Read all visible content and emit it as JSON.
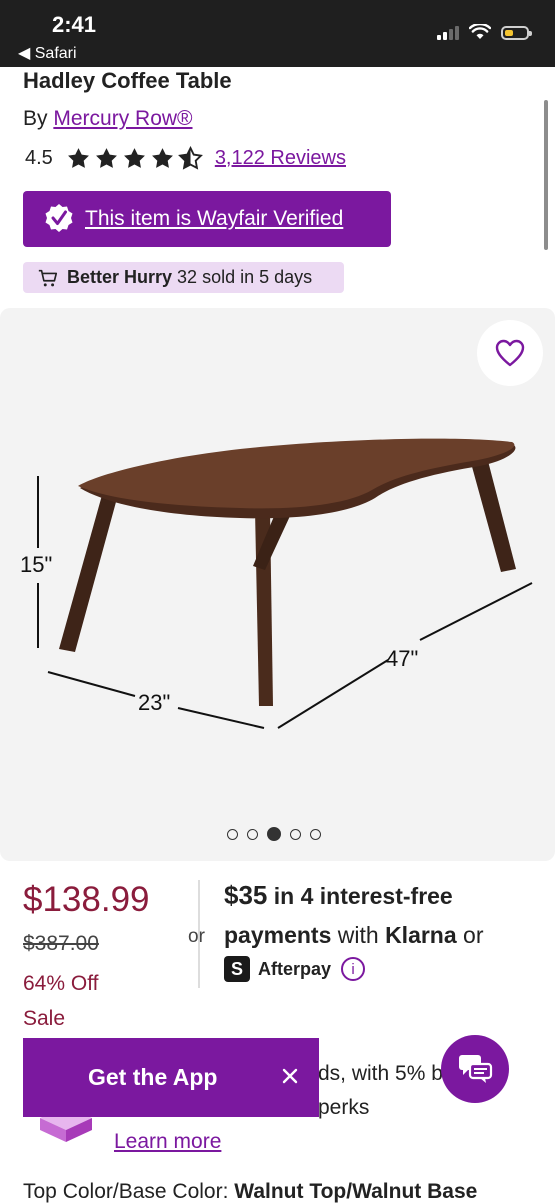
{
  "status_bar": {
    "time": "2:41",
    "back_label": "◀ Safari"
  },
  "product": {
    "title": "Hadley Coffee Table",
    "by_prefix": "By",
    "brand": "Mercury Row®",
    "rating": "4.5",
    "stars_value": 4.5,
    "reviews": "3,122 Reviews",
    "verified": "This item is Wayfair Verified",
    "hurry_bold": "Better Hurry",
    "hurry_text": "32 sold in 5 days"
  },
  "gallery": {
    "dims": {
      "height": "15\"",
      "depth": "23\"",
      "width": "47\""
    },
    "dots_total": 5,
    "active_dot": 3
  },
  "pricing": {
    "price": "$138.99",
    "original": "$387.00",
    "discount": "64% Off",
    "sale": "Sale",
    "or": "or",
    "klarna_amount": "$35",
    "klarna_line1_rest": "in 4 interest-free",
    "klarna_payments": "payments",
    "klarna_with": "with",
    "klarna_brand": "Klarna",
    "klarna_or": "or",
    "afterpay_icon": "S",
    "afterpay": "Afterpay",
    "info_icon": "i"
  },
  "card_promo": {
    "line1": "ds, with 5% b",
    "line2": "perks",
    "learn_more": "Learn more"
  },
  "options_partial": {
    "label": "Top Color/Base Color:",
    "value": "Walnut Top/Walnut Base"
  },
  "app_banner": {
    "label": "Get the App"
  },
  "colors": {
    "brand_purple": "#7b189f",
    "price_red": "#8a1c3c",
    "hurry_bg": "#ecdaf3"
  }
}
